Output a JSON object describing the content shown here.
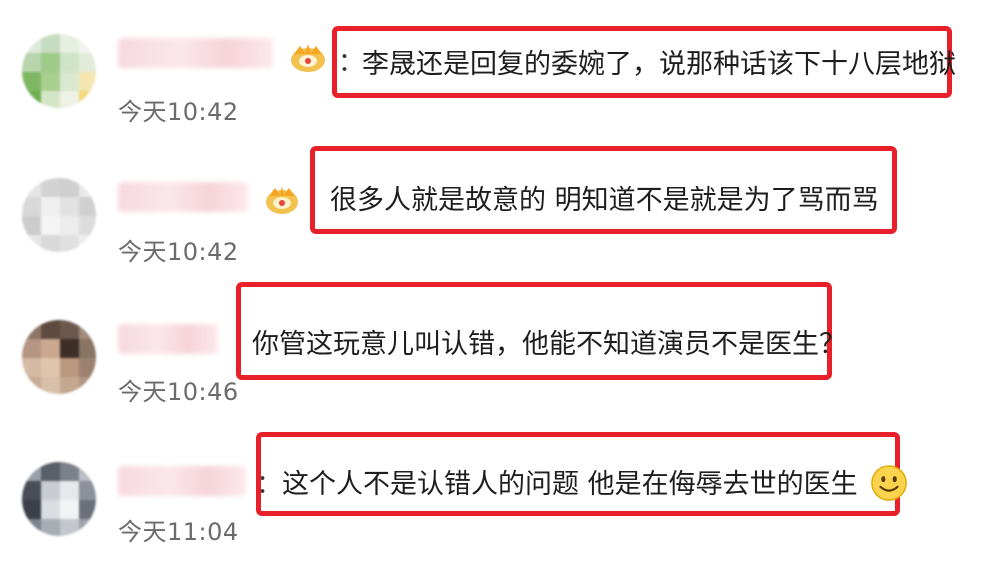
{
  "accent_color": "#e8202a",
  "comments": [
    {
      "badge_icon": "crown-badge-icon",
      "time": "今天10:42",
      "separator": "：",
      "text": "李晟还是回复的委婉了，说那种话该下十八层地狱"
    },
    {
      "badge_icon": "crown-badge-icon",
      "time": "今天10:42",
      "separator": "",
      "text": "很多人就是故意的 明知道不是就是为了骂而骂"
    },
    {
      "badge_icon": "",
      "time": "今天10:46",
      "separator": "：",
      "text": "你管这玩意儿叫认错，他能不知道演员不是医生？"
    },
    {
      "badge_icon": "",
      "time": "今天11:04",
      "separator": "：",
      "text": "这个人不是认错人的问题 他是在侮辱去世的医生",
      "trailing_emoji": "smile-emoji-icon"
    }
  ]
}
